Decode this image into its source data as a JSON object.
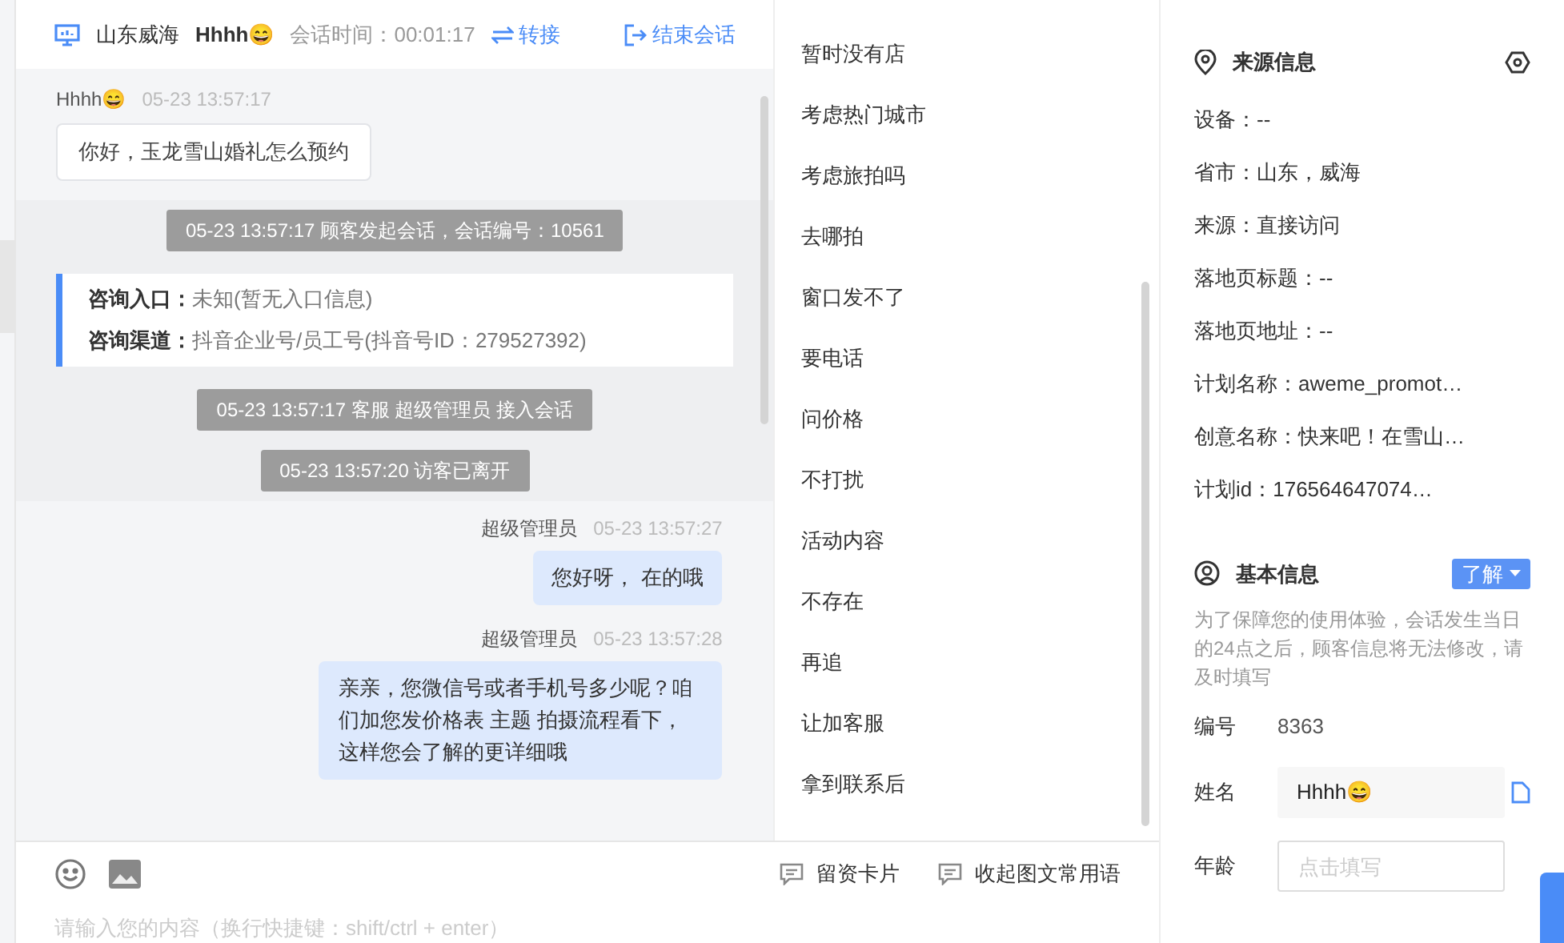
{
  "header": {
    "location": "山东威海",
    "visitor": "Hhhh😄",
    "timer_label": "会话时间：",
    "timer": "00:01:17",
    "transfer": "转接",
    "end": "结束会话"
  },
  "messages": [
    {
      "kind": "visitor",
      "sender": "Hhhh😄",
      "time": "05-23 13:57:17",
      "text": "你好，玉龙雪山婚礼怎么预约"
    },
    {
      "kind": "system",
      "text": "05-23 13:57:17 顾客发起会话，会话编号：10561"
    },
    {
      "kind": "info",
      "rows": [
        {
          "label": "咨询入口：",
          "value": "未知(暂无入口信息)"
        },
        {
          "label": "咨询渠道：",
          "value": "抖音企业号/员工号(抖音号ID：279527392)"
        }
      ]
    },
    {
      "kind": "system",
      "text": "05-23 13:57:17 客服 超级管理员 接入会话"
    },
    {
      "kind": "system",
      "text": "05-23 13:57:20 访客已离开"
    },
    {
      "kind": "agent",
      "sender": "超级管理员",
      "time": "05-23 13:57:27",
      "text": "您好呀， 在的哦"
    },
    {
      "kind": "agent",
      "sender": "超级管理员",
      "time": "05-23 13:57:28",
      "text": "亲亲，您微信号或者手机号多少呢？咱们加您发价格表 主题 拍摄流程看下，这样您会了解的更详细哦"
    }
  ],
  "quick_replies": [
    "暂时没有店",
    "考虑热门城市",
    "考虑旅拍吗",
    "去哪拍",
    "窗口发不了",
    "要电话",
    "问价格",
    "不打扰",
    "活动内容",
    "不存在",
    "再追",
    "让加客服",
    "拿到联系后"
  ],
  "composer": {
    "placeholder": "请输入您的内容（换行快捷键：shift/ctrl + enter）",
    "buttons": [
      "留资卡片",
      "收起图文常用语"
    ]
  },
  "source_info": {
    "title": "来源信息",
    "rows": [
      "设备：--",
      "省市：山东，威海",
      "来源：直接访问",
      "落地页标题：--",
      "落地页地址：--",
      "计划名称：aweme_promot…",
      "创意名称：快来吧！在雪山…",
      "计划id：176564647074…"
    ]
  },
  "basic_info": {
    "title": "基本信息",
    "dropdown": "了解",
    "notice": "为了保障您的使用体验，会话发生当日的24点之后，顾客信息将无法修改，请及时填写",
    "fields": [
      {
        "kind": "text",
        "label": "编号",
        "value": "8363"
      },
      {
        "kind": "input",
        "label": "姓名",
        "value": "Hhhh😄"
      },
      {
        "kind": "input",
        "label": "年龄",
        "placeholder": "点击填写"
      }
    ]
  }
}
